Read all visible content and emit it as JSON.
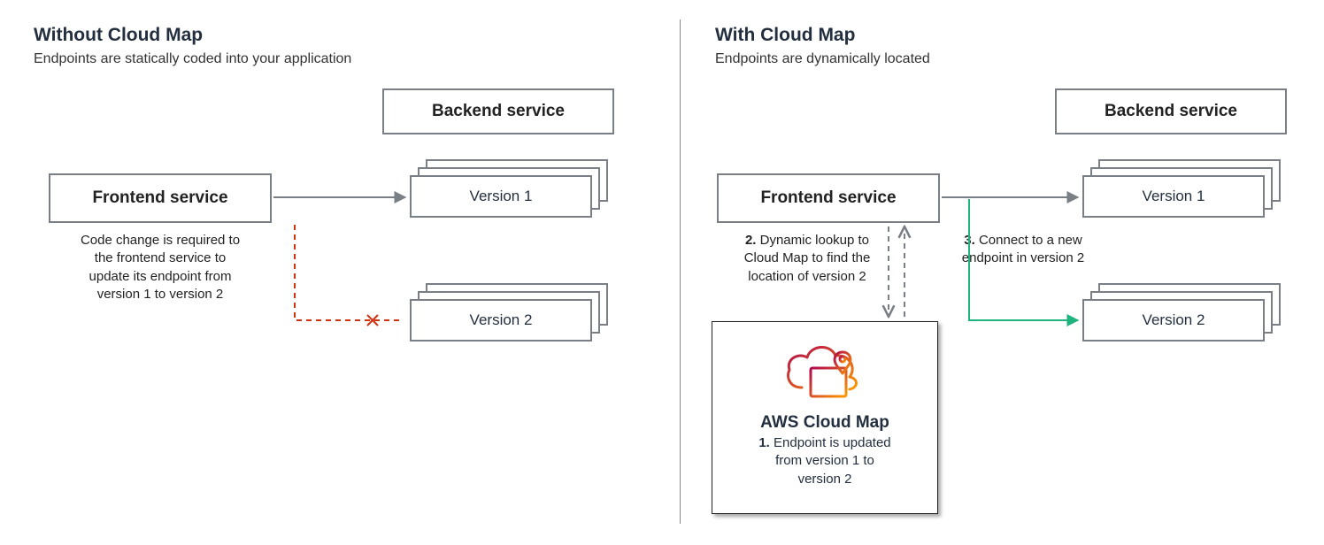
{
  "left": {
    "title": "Without Cloud Map",
    "subtitle": "Endpoints are statically coded into your application",
    "frontend": "Frontend service",
    "backend_label": "Backend service",
    "v1": "Version 1",
    "v2": "Version 2",
    "note": "Code change is required to\nthe frontend service to\nupdate its endpoint from\nversion 1 to version 2"
  },
  "right": {
    "title": "With Cloud Map",
    "subtitle": "Endpoints are dynamically located",
    "frontend": "Frontend service",
    "backend_label": "Backend service",
    "v1": "Version 1",
    "v2": "Version 2",
    "step2_b": "2.",
    "step2": " Dynamic lookup to\nCloud Map to find the\nlocation of version 2",
    "step3_b": "3.",
    "step3": " Connect to a new\nendpoint in version 2",
    "cloudmap_title": "AWS Cloud Map",
    "step1_b": "1.",
    "step1": " Endpoint is updated\nfrom version 1 to\nversion 2"
  },
  "colors": {
    "gray": "#7a7f85",
    "red": "#d13212",
    "green": "#1fb37d",
    "orange1": "#b0084d",
    "orange2": "#ff9900"
  }
}
